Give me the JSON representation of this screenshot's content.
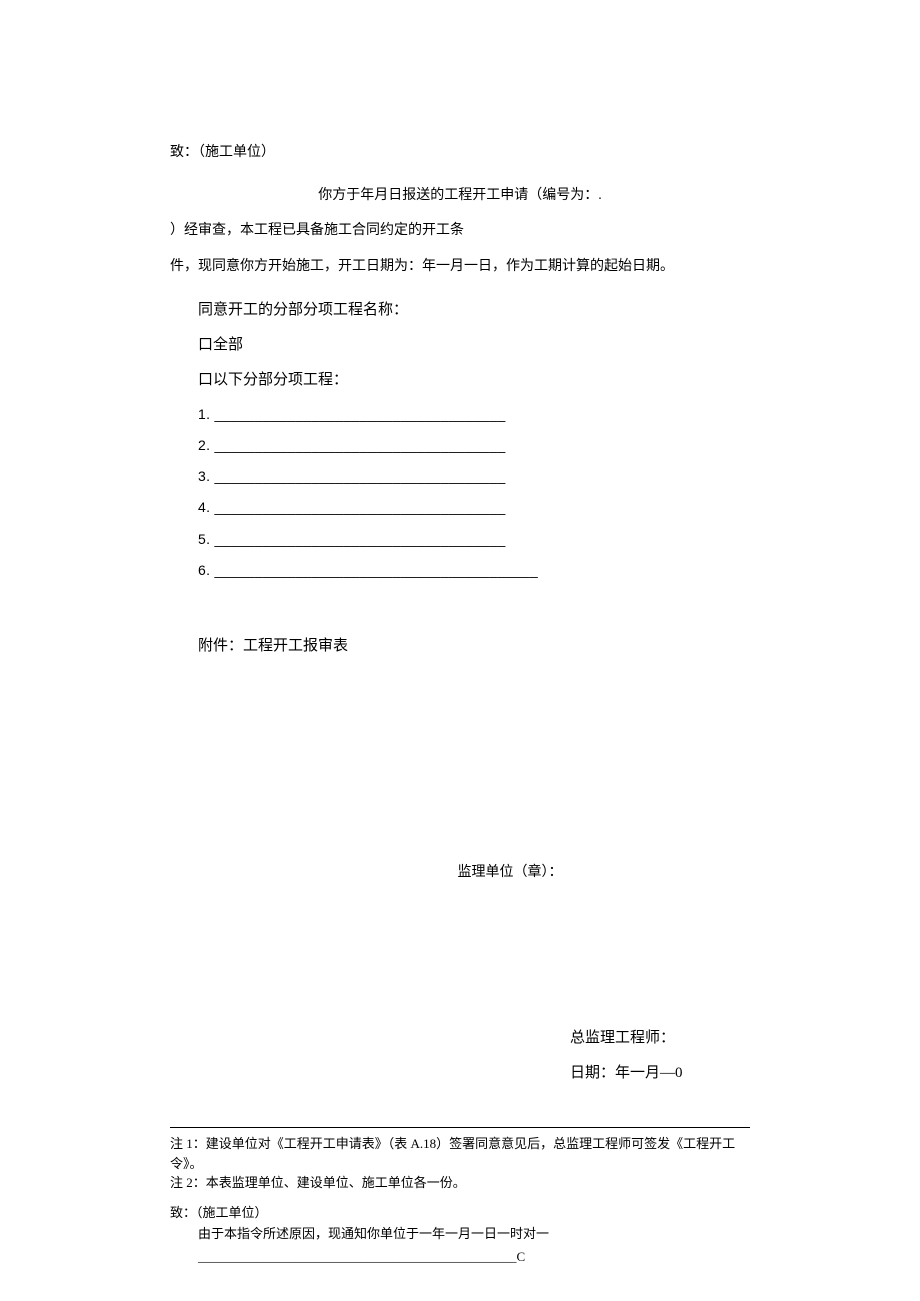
{
  "to": "致：（施工单位）",
  "centerLine": "你方于年月日报送的工程开工申请（编号为：.",
  "body1": "）经审查，本工程已具备施工合同约定的开工条",
  "body2": "件，现同意你方开始施工，开工日期为：年一月一日，作为工期计算的起始日期。",
  "sectionTitle": "同意开工的分部分项工程名称：",
  "optAll": "口全部",
  "optPartial": "口以下分部分项工程：",
  "item1": "1. ____________________________________",
  "item2": "2. ____________________________________",
  "item3": "3. ____________________________________",
  "item4": "4. ____________________________________",
  "item5": "5. ____________________________________",
  "item6": "6. ________________________________________",
  "attachment": "附件：工程开工报审表",
  "stamp": "监理单位（章）：",
  "signer": "总监理工程师：",
  "date": "日期：年一月—0",
  "note1": "注 1：建设单位对《工程开工申请表》（表 A.18）签署同意意见后，总监理工程师可签发《工程开工令》。",
  "note2": "注 2：本表监理单位、建设单位、施工单位各一份。",
  "to2": "致：（施工单位）",
  "reason": "由于本指令所述原因，现通知你单位于一年一月一日一时对一",
  "cLine": "_________________________________________________C"
}
